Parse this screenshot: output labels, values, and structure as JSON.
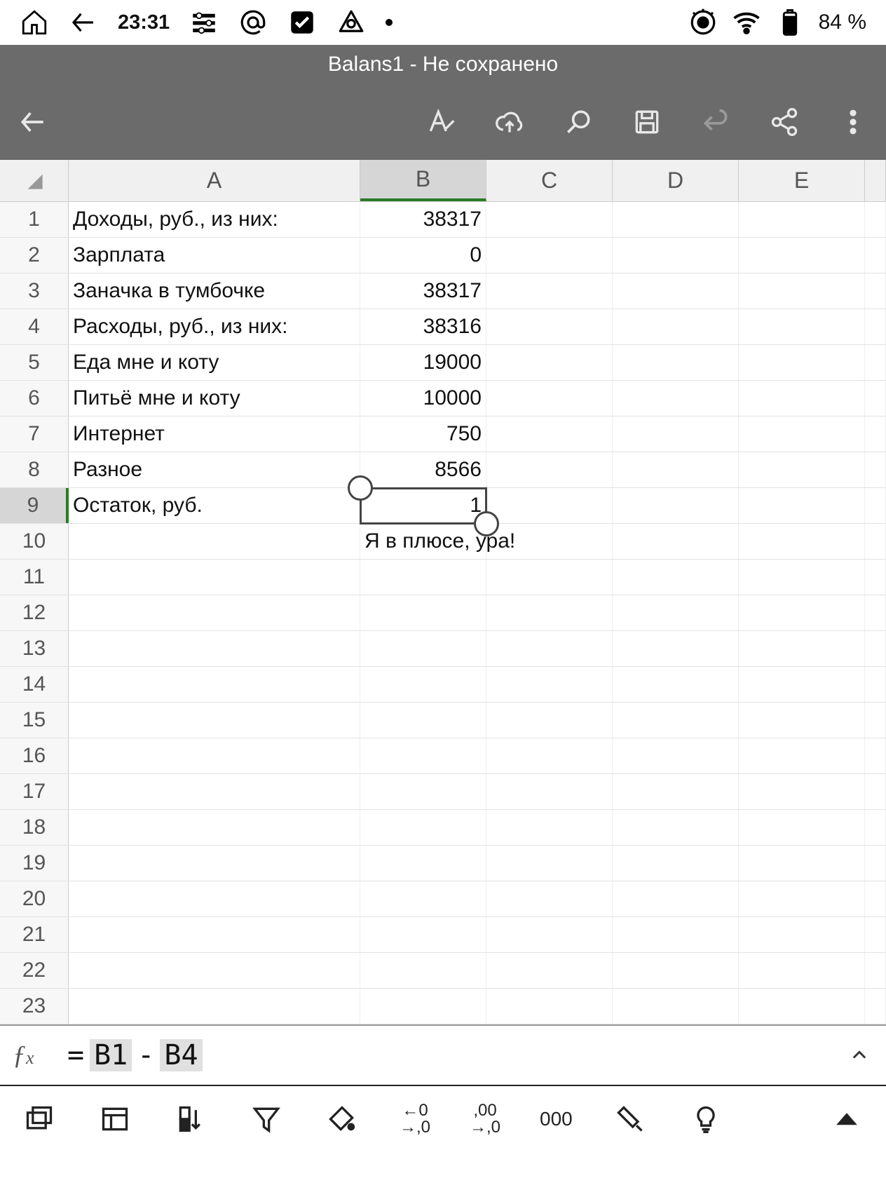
{
  "status": {
    "time": "23:31",
    "battery": "84 %"
  },
  "title": "Balans1 - Не сохранено",
  "columns": [
    "A",
    "B",
    "C",
    "D",
    "E"
  ],
  "selected_col": "B",
  "selected_row": 9,
  "rows": [
    {
      "n": 1,
      "A": "Доходы, руб., из них:",
      "B": "38317"
    },
    {
      "n": 2,
      "A": "Зарплата",
      "B": "0"
    },
    {
      "n": 3,
      "A": "Заначка в тумбочке",
      "B": "38317"
    },
    {
      "n": 4,
      "A": "Расходы, руб., из них:",
      "B": "38316"
    },
    {
      "n": 5,
      "A": "Еда мне и коту",
      "B": "19000"
    },
    {
      "n": 6,
      "A": "Питьё мне и коту",
      "B": "10000"
    },
    {
      "n": 7,
      "A": "Интернет",
      "B": "750"
    },
    {
      "n": 8,
      "A": "Разное",
      "B": "8566"
    },
    {
      "n": 9,
      "A": "Остаток, руб.",
      "B": "1"
    },
    {
      "n": 10,
      "A": "",
      "B": "Я в плюсе, ура!",
      "B_txt": true
    },
    {
      "n": 11
    },
    {
      "n": 12
    },
    {
      "n": 13
    },
    {
      "n": 14
    },
    {
      "n": 15
    },
    {
      "n": 16
    },
    {
      "n": 17
    },
    {
      "n": 18
    },
    {
      "n": 19
    },
    {
      "n": 20
    },
    {
      "n": 21
    },
    {
      "n": 22
    },
    {
      "n": 23
    }
  ],
  "formula": {
    "prefix": "=",
    "ref1": "B1",
    "op": "-",
    "ref2": "B4"
  },
  "bottom": {
    "dec_left": "←0\n→,0",
    "dec_right": ",00\n→,0",
    "thousands": "000"
  }
}
